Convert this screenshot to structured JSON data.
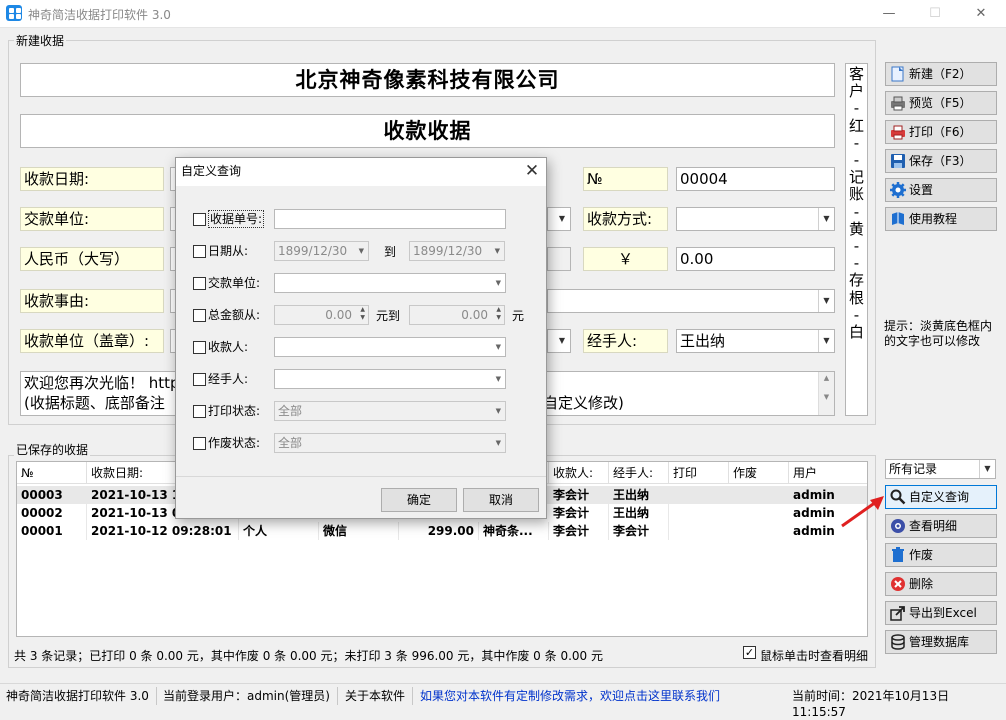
{
  "window": {
    "title": "神奇简洁收据打印软件 3.0",
    "min": "—",
    "max": "☐",
    "close": "✕"
  },
  "form": {
    "group_label": "新建收据",
    "company": "北京神奇像素科技有限公司",
    "receipt_title": "收款收据",
    "date_label": "收款日期:",
    "no_label": "№",
    "no_value": "00004",
    "payer_label": "交款单位:",
    "pay_method_label": "收款方式:",
    "rmb_upper_label": "人民币（大写）",
    "yen_symbol": "￥",
    "amount_value": "0.00",
    "reason_label": "收款事由:",
    "seal_label": "收款单位（盖章）:",
    "handler_label": "经手人:",
    "handler_value": "王出纳",
    "note_line1": "欢迎您再次光临！ http",
    "note_line1_tail": "",
    "note_line2": "(收据标题、底部备注",
    "note_line2_tail": "自定义修改)",
    "side_vertical": [
      "客",
      "户",
      "-",
      "红",
      "-",
      "-",
      "记",
      "账",
      "-",
      "黄",
      "-",
      "-",
      "存",
      "根",
      "-",
      "白"
    ]
  },
  "right_panel": {
    "buttons": [
      {
        "label": "新建（F2）",
        "icon": "new-doc-icon"
      },
      {
        "label": "预览（F5）",
        "icon": "preview-icon"
      },
      {
        "label": "打印（F6）",
        "icon": "printer-icon"
      },
      {
        "label": "保存（F3）",
        "icon": "save-icon"
      },
      {
        "label": "设置",
        "icon": "gear-icon"
      },
      {
        "label": "使用教程",
        "icon": "book-icon"
      }
    ],
    "hint_line1": "提示：淡黄底色框内",
    "hint_line2": "的文字也可以修改",
    "filter_value": "所有记录",
    "list_buttons": [
      {
        "label": "自定义查询",
        "icon": "search-icon"
      },
      {
        "label": "查看明细",
        "icon": "view-icon"
      },
      {
        "label": "作废",
        "icon": "trash-icon"
      },
      {
        "label": "删除",
        "icon": "delete-icon"
      },
      {
        "label": "导出到Excel",
        "icon": "export-icon"
      },
      {
        "label": "管理数据库",
        "icon": "database-icon"
      }
    ]
  },
  "saved": {
    "group_label": "已保存的收据",
    "columns": [
      "№",
      "收款日期:",
      "",
      "",
      "",
      "",
      "收款人:",
      "经手人:",
      "打印",
      "作废",
      "用户"
    ],
    "rows": [
      [
        "00003",
        "2021-10-13 1",
        "",
        "",
        "",
        "",
        "李会计",
        "王出纳",
        "",
        "",
        "admin"
      ],
      [
        "00002",
        "2021-10-13 0",
        "",
        "",
        "",
        "",
        "李会计",
        "王出纳",
        "",
        "",
        "admin"
      ],
      [
        "00001",
        "2021-10-12 09:28:01",
        "个人",
        "微信",
        "299.00",
        "神奇条...",
        "李会计",
        "李会计",
        "",
        "",
        "admin"
      ]
    ],
    "summary": "共 3 条记录；已打印 0 条 0.00 元，其中作废 0 条 0.00 元；未打印 3 条 996.00 元，其中作废 0 条 0.00 元",
    "detail_checkbox_label": "鼠标单击时查看明细",
    "detail_checked": "✓"
  },
  "dialog": {
    "title": "自定义查询",
    "close": "✕",
    "receipt_no_label": "收据单号:",
    "date_from_label": "日期从:",
    "date_from": "1899/12/30",
    "date_to_label": "到",
    "date_to": "1899/12/30",
    "payer_label": "交款单位:",
    "amount_from_label": "总金额从:",
    "amount_from": "0.00",
    "amount_to_label": "元到",
    "amount_to": "0.00",
    "amount_unit": "元",
    "payee_label": "收款人:",
    "handler_label": "经手人:",
    "print_status_label": "打印状态:",
    "print_status": "全部",
    "void_status_label": "作废状态:",
    "void_status": "全部",
    "ok": "确定",
    "cancel": "取消"
  },
  "statusbar": {
    "app": "神奇简洁收据打印软件 3.0",
    "user": "当前登录用户：admin(管理员)",
    "about": "关于本软件",
    "link": "如果您对本软件有定制修改需求，欢迎点击这里联系我们",
    "time": "当前时间：2021年10月13日 11:15:57"
  },
  "colors": {
    "field_yellow": "#ffffe1",
    "link_blue": "#0033cc",
    "arrow_red": "#e02020"
  }
}
